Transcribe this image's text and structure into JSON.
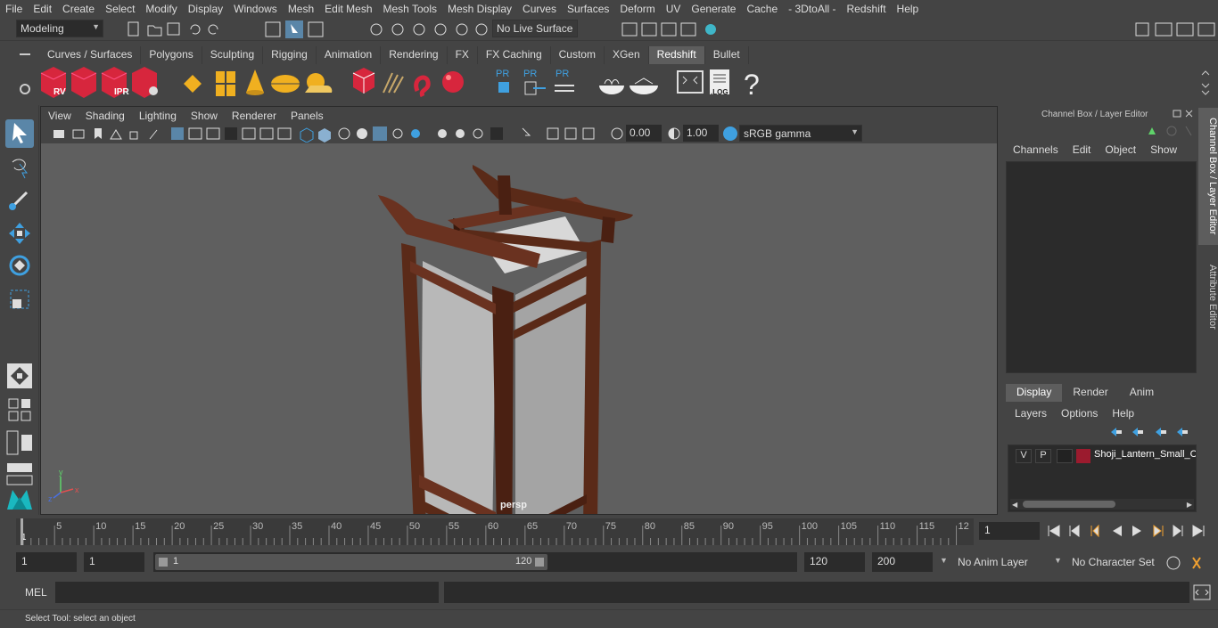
{
  "menu": [
    "File",
    "Edit",
    "Create",
    "Select",
    "Modify",
    "Display",
    "Windows",
    "Mesh",
    "Edit Mesh",
    "Mesh Tools",
    "Mesh Display",
    "Curves",
    "Surfaces",
    "Deform",
    "UV",
    "Generate",
    "Cache",
    "- 3DtoAll -",
    "Redshift",
    "Help"
  ],
  "status": {
    "mode": "Modeling",
    "live_surface": "No Live Surface"
  },
  "shelf_tabs": [
    "Curves / Surfaces",
    "Polygons",
    "Sculpting",
    "Rigging",
    "Animation",
    "Rendering",
    "FX",
    "FX Caching",
    "Custom",
    "XGen",
    "Redshift",
    "Bullet"
  ],
  "active_shelf": "Redshift",
  "shelf_labels": {
    "rv": "RV",
    "ipr": "IPR",
    "pr1": "PR",
    "pr2": "PR",
    "pr3": "PR",
    "log": ".LOG",
    "help": "?"
  },
  "panel_menu": [
    "View",
    "Shading",
    "Lighting",
    "Show",
    "Renderer",
    "Panels"
  ],
  "panel_tools": {
    "exposure": "0.00",
    "gamma": "1.00",
    "colorspace": "sRGB gamma"
  },
  "viewport": {
    "camera": "persp",
    "axis_x": "x",
    "axis_y": "y",
    "axis_z": "z"
  },
  "channel_box": {
    "title": "Channel Box / Layer Editor",
    "menu": [
      "Channels",
      "Edit",
      "Object",
      "Show"
    ]
  },
  "layer_editor": {
    "tabs": [
      "Display",
      "Render",
      "Anim"
    ],
    "active": "Display",
    "menu": [
      "Layers",
      "Options",
      "Help"
    ],
    "layers": [
      {
        "v": "V",
        "p": "P",
        "name": "Shoji_Lantern_Small_C",
        "color": "#9b1b2e"
      }
    ]
  },
  "side_tabs": [
    "Channel Box / Layer Editor",
    "Attribute Editor"
  ],
  "timeline": {
    "ticks": [
      "5",
      "10",
      "15",
      "20",
      "25",
      "30",
      "35",
      "40",
      "45",
      "50",
      "55",
      "60",
      "65",
      "70",
      "75",
      "80",
      "85",
      "90",
      "95",
      "100",
      "105",
      "110",
      "115",
      "12"
    ],
    "start_tick": "1",
    "current_frame": "1"
  },
  "range": {
    "start": "1",
    "start2": "1",
    "slider_start": "1",
    "slider_end": "120",
    "end": "120",
    "end2": "200",
    "anim_layer": "No Anim Layer",
    "char_set": "No Character Set"
  },
  "cmd": {
    "lang": "MEL"
  },
  "help": "Select Tool: select an object",
  "colors": {
    "accent": "#5d5d5d",
    "redshift_red": "#d7263d",
    "wood": "#5a2a18",
    "paper": "#b8b8b8",
    "yellow": "#f0b020"
  }
}
